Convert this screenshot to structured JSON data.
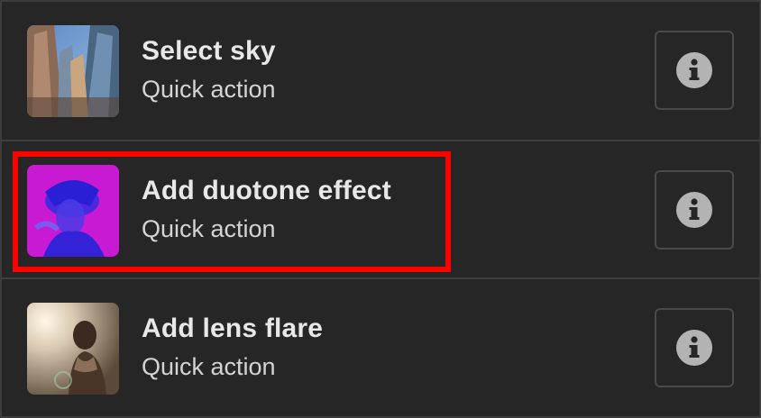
{
  "items": [
    {
      "title": "Select sky",
      "subtitle": "Quick action",
      "thumbnail": "city-skyscrapers-thumbnail",
      "info_icon": "info-icon"
    },
    {
      "title": "Add duotone effect",
      "subtitle": "Quick action",
      "thumbnail": "duotone-portrait-thumbnail",
      "info_icon": "info-icon"
    },
    {
      "title": "Add lens flare",
      "subtitle": "Quick action",
      "thumbnail": "lens-flare-portrait-thumbnail",
      "info_icon": "info-icon"
    }
  ],
  "colors": {
    "background": "#262626",
    "divider": "#3e3e3e",
    "text_primary": "#e8e8e8",
    "highlight": "#ff0000",
    "duotone_magenta": "#c81ad2",
    "duotone_blue": "#3a2be0"
  }
}
